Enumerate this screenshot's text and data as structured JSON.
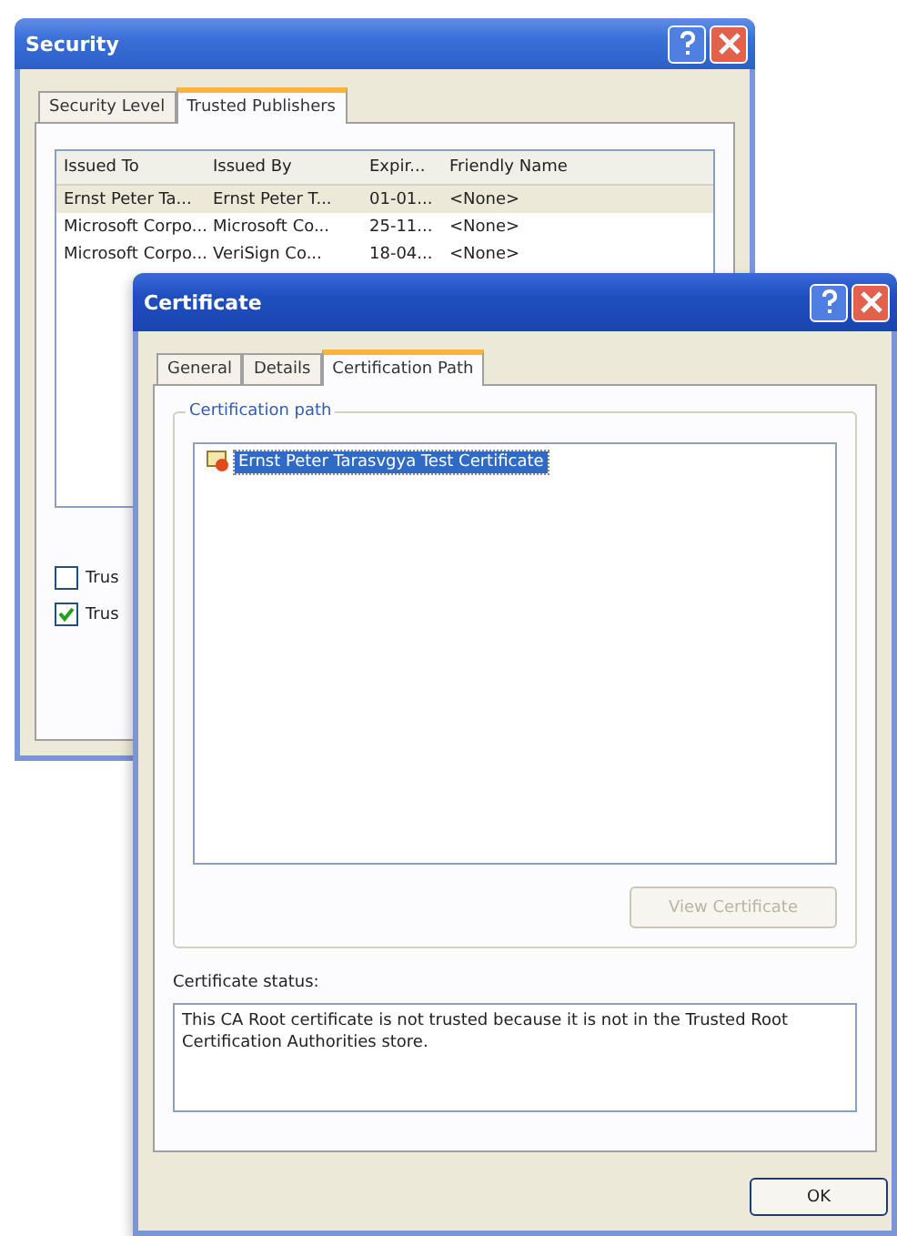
{
  "security_window": {
    "title": "Security",
    "tabs": [
      {
        "label": "Security Level",
        "selected": false
      },
      {
        "label": "Trusted Publishers",
        "selected": true
      }
    ],
    "table": {
      "columns": [
        "Issued To",
        "Issued By",
        "Expir...",
        "Friendly Name"
      ],
      "rows": [
        {
          "cells": [
            "Ernst Peter Ta...",
            "Ernst Peter T...",
            "01-01...",
            "<None>"
          ],
          "selected": true
        },
        {
          "cells": [
            "Microsoft Corpo...",
            "Microsoft Co...",
            "25-11...",
            "<None>"
          ],
          "selected": false
        },
        {
          "cells": [
            "Microsoft Corpo...",
            "VeriSign Co...",
            "18-04...",
            "<None>"
          ],
          "selected": false
        }
      ]
    },
    "checkboxes": [
      {
        "label": "Trus",
        "checked": false
      },
      {
        "label": "Trus",
        "checked": true
      }
    ]
  },
  "certificate_window": {
    "title": "Certificate",
    "tabs": [
      {
        "label": "General",
        "selected": false
      },
      {
        "label": "Details",
        "selected": false
      },
      {
        "label": "Certification Path",
        "selected": true
      }
    ],
    "path_group": {
      "label": "Certification path",
      "items": [
        {
          "label": "Ernst Peter Tarasvgya Test Certificate",
          "selected": true
        }
      ]
    },
    "view_button": {
      "label": "View Certificate",
      "disabled": true
    },
    "status_label": "Certificate status:",
    "status_text": "This CA Root certificate is not trusted because it is not in the Trusted Root Certification Authorities store.",
    "ok_button": "OK"
  }
}
